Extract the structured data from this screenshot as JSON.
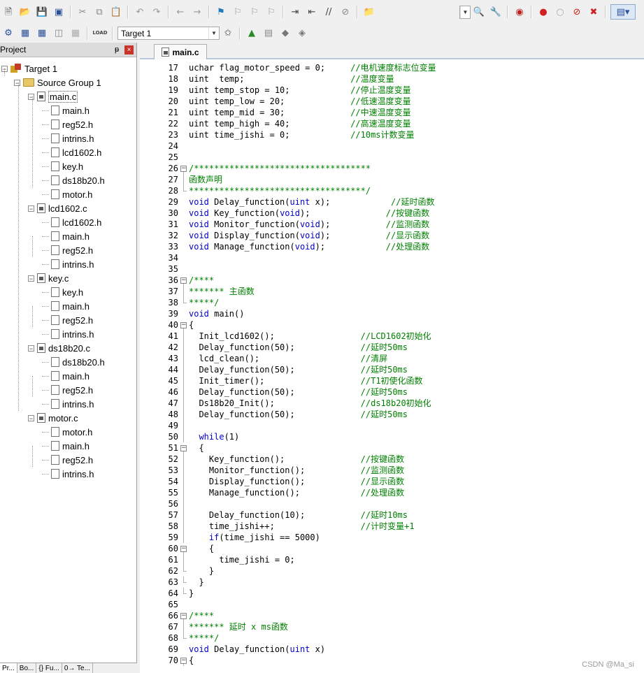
{
  "toolbar1": {
    "icons": [
      "new-file-icon",
      "open-file-icon",
      "save-icon",
      "save-all-icon",
      "cut-icon",
      "copy-icon",
      "paste-icon",
      "undo-icon",
      "redo-icon",
      "nav-back-icon",
      "nav-forward-icon",
      "bookmark-icon",
      "prev-bookmark-icon",
      "next-bookmark-icon",
      "clear-bookmarks-icon",
      "indent-icon",
      "unindent-icon",
      "comment-icon",
      "uncomment-icon",
      "find-in-files-icon"
    ],
    "right_icons": [
      "find-icon",
      "configure-icon",
      "debug-icon",
      "breakpoint-icon",
      "disable-breakpoint-icon",
      "kill-breakpoints-icon",
      "kill-all-icon",
      "window-layout-icon"
    ]
  },
  "toolbar2": {
    "target_select": "Target 1",
    "load_label": "LOAD"
  },
  "project_panel": {
    "title": "Project",
    "pin": "ᵽ",
    "close": "×",
    "tabs": [
      "Pr...",
      "Bo...",
      "{} Fu...",
      "0→ Te..."
    ]
  },
  "tree": [
    {
      "label": "Target 1",
      "type": "target",
      "level": 0,
      "expanded": true
    },
    {
      "label": "Source Group 1",
      "type": "folder",
      "level": 1,
      "expanded": true
    },
    {
      "label": "main.c",
      "type": "cfile",
      "level": 2,
      "expanded": true,
      "selected": true
    },
    {
      "label": "main.h",
      "type": "hfile",
      "level": 3
    },
    {
      "label": "reg52.h",
      "type": "hfile",
      "level": 3
    },
    {
      "label": "intrins.h",
      "type": "hfile",
      "level": 3
    },
    {
      "label": "lcd1602.h",
      "type": "hfile",
      "level": 3
    },
    {
      "label": "key.h",
      "type": "hfile",
      "level": 3
    },
    {
      "label": "ds18b20.h",
      "type": "hfile",
      "level": 3
    },
    {
      "label": "motor.h",
      "type": "hfile",
      "level": 3
    },
    {
      "label": "lcd1602.c",
      "type": "cfile",
      "level": 2,
      "expanded": true
    },
    {
      "label": "lcd1602.h",
      "type": "hfile",
      "level": 3
    },
    {
      "label": "main.h",
      "type": "hfile",
      "level": 3
    },
    {
      "label": "reg52.h",
      "type": "hfile",
      "level": 3
    },
    {
      "label": "intrins.h",
      "type": "hfile",
      "level": 3
    },
    {
      "label": "key.c",
      "type": "cfile",
      "level": 2,
      "expanded": true
    },
    {
      "label": "key.h",
      "type": "hfile",
      "level": 3
    },
    {
      "label": "main.h",
      "type": "hfile",
      "level": 3
    },
    {
      "label": "reg52.h",
      "type": "hfile",
      "level": 3
    },
    {
      "label": "intrins.h",
      "type": "hfile",
      "level": 3
    },
    {
      "label": "ds18b20.c",
      "type": "cfile",
      "level": 2,
      "expanded": true
    },
    {
      "label": "ds18b20.h",
      "type": "hfile",
      "level": 3
    },
    {
      "label": "main.h",
      "type": "hfile",
      "level": 3
    },
    {
      "label": "reg52.h",
      "type": "hfile",
      "level": 3
    },
    {
      "label": "intrins.h",
      "type": "hfile",
      "level": 3
    },
    {
      "label": "motor.c",
      "type": "cfile",
      "level": 2,
      "expanded": true
    },
    {
      "label": "motor.h",
      "type": "hfile",
      "level": 3
    },
    {
      "label": "main.h",
      "type": "hfile",
      "level": 3
    },
    {
      "label": "reg52.h",
      "type": "hfile",
      "level": 3
    },
    {
      "label": "intrins.h",
      "type": "hfile",
      "level": 3
    }
  ],
  "editor": {
    "tab_label": "main.c",
    "watermark": "CSDN @Ma_si",
    "lines": [
      {
        "n": "17",
        "fold": "",
        "seg": [
          [
            "",
            "uchar flag_motor_speed = 0;     "
          ],
          [
            "cmt",
            "//电机速度标志位变量"
          ]
        ]
      },
      {
        "n": "18",
        "fold": "",
        "seg": [
          [
            "",
            "uint  temp;                     "
          ],
          [
            "cmt",
            "//温度变量"
          ]
        ]
      },
      {
        "n": "19",
        "fold": "",
        "seg": [
          [
            "",
            "uint temp_stop = 10;            "
          ],
          [
            "cmt",
            "//停止温度变量"
          ]
        ]
      },
      {
        "n": "20",
        "fold": "",
        "seg": [
          [
            "",
            "uint temp_low = 20;             "
          ],
          [
            "cmt",
            "//低速温度变量"
          ]
        ]
      },
      {
        "n": "21",
        "fold": "",
        "seg": [
          [
            "",
            "uint temp_mid = 30;             "
          ],
          [
            "cmt",
            "//中速温度变量"
          ]
        ]
      },
      {
        "n": "22",
        "fold": "",
        "seg": [
          [
            "",
            "uint temp_high = 40;            "
          ],
          [
            "cmt",
            "//高速温度变量"
          ]
        ]
      },
      {
        "n": "23",
        "fold": "",
        "seg": [
          [
            "",
            "uint time_jishi = 0;            "
          ],
          [
            "cmt",
            "//10ms计数变量"
          ]
        ]
      },
      {
        "n": "24",
        "fold": "",
        "seg": []
      },
      {
        "n": "25",
        "fold": "",
        "seg": []
      },
      {
        "n": "26",
        "fold": "open",
        "seg": [
          [
            "cmt",
            "/***********************************"
          ]
        ]
      },
      {
        "n": "27",
        "fold": "line",
        "seg": [
          [
            "cmt",
            "函数声明"
          ]
        ]
      },
      {
        "n": "28",
        "fold": "end",
        "seg": [
          [
            "cmt",
            "***********************************/"
          ]
        ]
      },
      {
        "n": "29",
        "fold": "",
        "seg": [
          [
            "kw",
            "void"
          ],
          [
            "",
            " Delay_function("
          ],
          [
            "kw",
            "uint"
          ],
          [
            "",
            " x);            "
          ],
          [
            "cmt",
            "//延时函数"
          ]
        ]
      },
      {
        "n": "30",
        "fold": "",
        "seg": [
          [
            "kw",
            "void"
          ],
          [
            "",
            " Key_function("
          ],
          [
            "kw",
            "void"
          ],
          [
            "",
            ");               "
          ],
          [
            "cmt",
            "//按键函数"
          ]
        ]
      },
      {
        "n": "31",
        "fold": "",
        "seg": [
          [
            "kw",
            "void"
          ],
          [
            "",
            " Monitor_function("
          ],
          [
            "kw",
            "void"
          ],
          [
            "",
            ");           "
          ],
          [
            "cmt",
            "//监测函数"
          ]
        ]
      },
      {
        "n": "32",
        "fold": "",
        "seg": [
          [
            "kw",
            "void"
          ],
          [
            "",
            " Display_function("
          ],
          [
            "kw",
            "void"
          ],
          [
            "",
            ");           "
          ],
          [
            "cmt",
            "//显示函数"
          ]
        ]
      },
      {
        "n": "33",
        "fold": "",
        "seg": [
          [
            "kw",
            "void"
          ],
          [
            "",
            " Manage_function("
          ],
          [
            "kw",
            "void"
          ],
          [
            "",
            ");            "
          ],
          [
            "cmt",
            "//处理函数"
          ]
        ]
      },
      {
        "n": "34",
        "fold": "",
        "seg": []
      },
      {
        "n": "35",
        "fold": "",
        "seg": []
      },
      {
        "n": "36",
        "fold": "open",
        "seg": [
          [
            "cmt",
            "/****"
          ]
        ]
      },
      {
        "n": "37",
        "fold": "line",
        "seg": [
          [
            "cmt",
            "******* 主函数"
          ]
        ]
      },
      {
        "n": "38",
        "fold": "end",
        "seg": [
          [
            "cmt",
            "*****/"
          ]
        ]
      },
      {
        "n": "39",
        "fold": "",
        "seg": [
          [
            "kw",
            "void"
          ],
          [
            "",
            " main()"
          ]
        ]
      },
      {
        "n": "40",
        "fold": "open",
        "seg": [
          [
            "",
            "{"
          ]
        ]
      },
      {
        "n": "41",
        "fold": "line",
        "seg": [
          [
            "",
            "  Init_lcd1602();                 "
          ],
          [
            "cmt",
            "//LCD1602初始化"
          ]
        ]
      },
      {
        "n": "42",
        "fold": "line",
        "seg": [
          [
            "",
            "  Delay_function(50);             "
          ],
          [
            "cmt",
            "//延时50ms"
          ]
        ]
      },
      {
        "n": "43",
        "fold": "line",
        "seg": [
          [
            "",
            "  lcd_clean();                    "
          ],
          [
            "cmt",
            "//清屏"
          ]
        ]
      },
      {
        "n": "44",
        "fold": "line",
        "seg": [
          [
            "",
            "  Delay_function(50);             "
          ],
          [
            "cmt",
            "//延时50ms"
          ]
        ]
      },
      {
        "n": "45",
        "fold": "line",
        "seg": [
          [
            "",
            "  Init_timer();                   "
          ],
          [
            "cmt",
            "//T1初使化函数"
          ]
        ]
      },
      {
        "n": "46",
        "fold": "line",
        "seg": [
          [
            "",
            "  Delay_function(50);             "
          ],
          [
            "cmt",
            "//延时50ms"
          ]
        ]
      },
      {
        "n": "47",
        "fold": "line",
        "seg": [
          [
            "",
            "  Ds18b20_Init();                 "
          ],
          [
            "cmt",
            "//ds18b20初始化"
          ]
        ]
      },
      {
        "n": "48",
        "fold": "line",
        "seg": [
          [
            "",
            "  Delay_function(50);             "
          ],
          [
            "cmt",
            "//延时50ms"
          ]
        ]
      },
      {
        "n": "49",
        "fold": "line",
        "seg": []
      },
      {
        "n": "50",
        "fold": "line",
        "seg": [
          [
            "",
            "  "
          ],
          [
            "kw",
            "while"
          ],
          [
            "",
            "(1)"
          ]
        ]
      },
      {
        "n": "51",
        "fold": "open",
        "seg": [
          [
            "",
            "  {"
          ]
        ]
      },
      {
        "n": "52",
        "fold": "line",
        "seg": [
          [
            "",
            "    Key_function();               "
          ],
          [
            "cmt",
            "//按键函数"
          ]
        ]
      },
      {
        "n": "53",
        "fold": "line",
        "seg": [
          [
            "",
            "    Monitor_function();           "
          ],
          [
            "cmt",
            "//监测函数"
          ]
        ]
      },
      {
        "n": "54",
        "fold": "line",
        "seg": [
          [
            "",
            "    Display_function();           "
          ],
          [
            "cmt",
            "//显示函数"
          ]
        ]
      },
      {
        "n": "55",
        "fold": "line",
        "seg": [
          [
            "",
            "    Manage_function();            "
          ],
          [
            "cmt",
            "//处理函数"
          ]
        ]
      },
      {
        "n": "56",
        "fold": "line",
        "seg": []
      },
      {
        "n": "57",
        "fold": "line",
        "seg": [
          [
            "",
            "    Delay_function(10);           "
          ],
          [
            "cmt",
            "//延时10ms"
          ]
        ]
      },
      {
        "n": "58",
        "fold": "line",
        "seg": [
          [
            "",
            "    time_jishi++;                 "
          ],
          [
            "cmt",
            "//计时变量+1"
          ]
        ]
      },
      {
        "n": "59",
        "fold": "line",
        "seg": [
          [
            "",
            "    "
          ],
          [
            "kw",
            "if"
          ],
          [
            "",
            "(time_jishi == 5000)"
          ]
        ]
      },
      {
        "n": "60",
        "fold": "open",
        "seg": [
          [
            "",
            "    {"
          ]
        ]
      },
      {
        "n": "61",
        "fold": "line",
        "seg": [
          [
            "",
            "      time_jishi = 0;"
          ]
        ]
      },
      {
        "n": "62",
        "fold": "end",
        "seg": [
          [
            "",
            "    }"
          ]
        ]
      },
      {
        "n": "63",
        "fold": "end",
        "seg": [
          [
            "",
            "  }"
          ]
        ]
      },
      {
        "n": "64",
        "fold": "end",
        "seg": [
          [
            "",
            "}"
          ]
        ]
      },
      {
        "n": "65",
        "fold": "",
        "seg": []
      },
      {
        "n": "66",
        "fold": "open",
        "seg": [
          [
            "cmt",
            "/****"
          ]
        ]
      },
      {
        "n": "67",
        "fold": "line",
        "seg": [
          [
            "cmt",
            "******* 延时 x ms函数"
          ]
        ]
      },
      {
        "n": "68",
        "fold": "end",
        "seg": [
          [
            "cmt",
            "*****/"
          ]
        ]
      },
      {
        "n": "69",
        "fold": "",
        "seg": [
          [
            "kw",
            "void"
          ],
          [
            "",
            " Delay_function("
          ],
          [
            "kw",
            "uint"
          ],
          [
            "",
            " x)"
          ]
        ]
      },
      {
        "n": "70",
        "fold": "open",
        "seg": [
          [
            "",
            "{"
          ]
        ]
      }
    ]
  }
}
